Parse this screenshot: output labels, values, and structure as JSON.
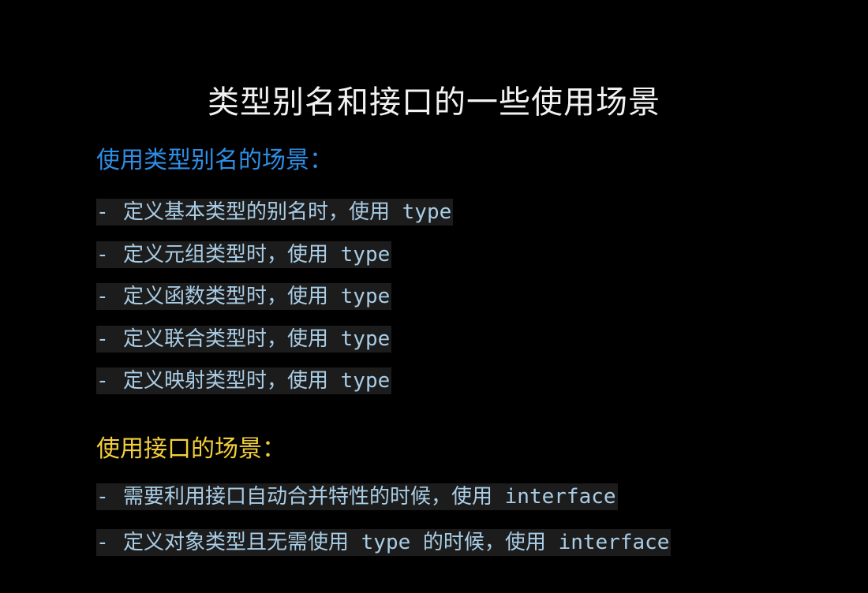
{
  "title": "类型别名和接口的一些使用场景",
  "type_alias_section": {
    "heading": "使用类型别名的场景：",
    "items": [
      "定义基本类型的别名时，使用 type",
      "定义元组类型时，使用 type",
      "定义函数类型时，使用 type",
      "定义联合类型时，使用 type",
      "定义映射类型时，使用 type"
    ]
  },
  "interface_section": {
    "heading": "使用接口的场景：",
    "items": [
      "需要利用接口自动合并特性的时候，使用 interface",
      "定义对象类型且无需使用 type 的时候，使用 interface"
    ]
  },
  "bullet": "-",
  "colors": {
    "background": "#000000",
    "title": "#f2f2f2",
    "type_heading": "#2e8ee6",
    "interface_heading": "#f4cf3c",
    "item_text": "#a9cde6",
    "item_bg": "#1c1c1c"
  }
}
